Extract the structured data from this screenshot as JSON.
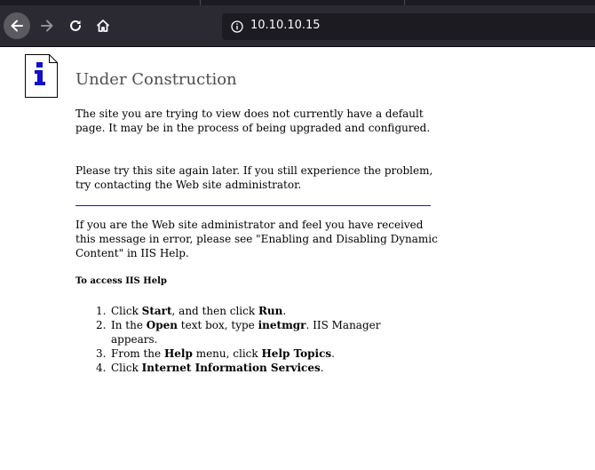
{
  "browser": {
    "url": "10.10.10.15",
    "buttons": {
      "back": "back-arrow-icon",
      "forward": "forward-arrow-icon",
      "reload": "reload-icon",
      "home": "home-icon"
    }
  },
  "page": {
    "title": "Under Construction",
    "para1": "The site you are trying to view does not currently have a default page. It may be in the process of being upgraded and configured.",
    "para2": "Please try this site again later. If you still experience the problem, try contacting the Web site administrator.",
    "para3": "If you are the Web site administrator and feel you have received this message in error, please see \"Enabling and Disabling Dynamic Content\" in IIS Help.",
    "help_heading": "To access IIS Help",
    "steps": [
      {
        "num": "1.",
        "t1": "Click ",
        "b1": "Start",
        "t2": ", and then click ",
        "b2": "Run",
        "t3": "."
      },
      {
        "num": "2.",
        "t1": "In the ",
        "b1": "Open",
        "t2": " text box, type ",
        "b2": "inetmgr",
        "t3": ". IIS Manager appears."
      },
      {
        "num": "3.",
        "t1": "From the ",
        "b1": "Help",
        "t2": " menu, click ",
        "b2": "Help Topics",
        "t3": "."
      },
      {
        "num": "4.",
        "t1": "Click ",
        "b1": "Internet Information Services",
        "t2": ".",
        "b2": "",
        "t3": ""
      }
    ]
  },
  "colors": {
    "toolbar": "#2b2a33",
    "urlbar": "#1c1b22",
    "title": "#4e4e4e",
    "rule": "#1b1bb0",
    "info_icon_blue": "#1010c8"
  }
}
